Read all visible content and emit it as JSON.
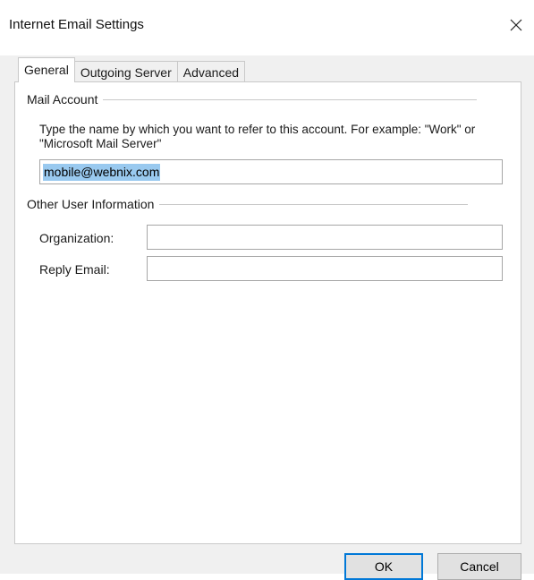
{
  "window": {
    "title": "Internet Email Settings",
    "close_icon": "close-icon"
  },
  "tabs": [
    {
      "label": "General",
      "active": true
    },
    {
      "label": "Outgoing Server",
      "active": false
    },
    {
      "label": "Advanced",
      "active": false
    }
  ],
  "mail_account": {
    "header": "Mail Account",
    "description": "Type the name by which you want to refer to this account. For example: \"Work\" or \"Microsoft Mail Server\"",
    "value": "mobile@webnix.com"
  },
  "other_user_info": {
    "header": "Other User Information",
    "organization_label": "Organization:",
    "organization_value": "",
    "reply_email_label": "Reply Email:",
    "reply_email_value": ""
  },
  "buttons": {
    "ok_label": "OK",
    "cancel_label": "Cancel"
  },
  "colors": {
    "selection": "#99c9ef",
    "accent": "#0078d7",
    "panel_background": "#f0f0f0"
  }
}
